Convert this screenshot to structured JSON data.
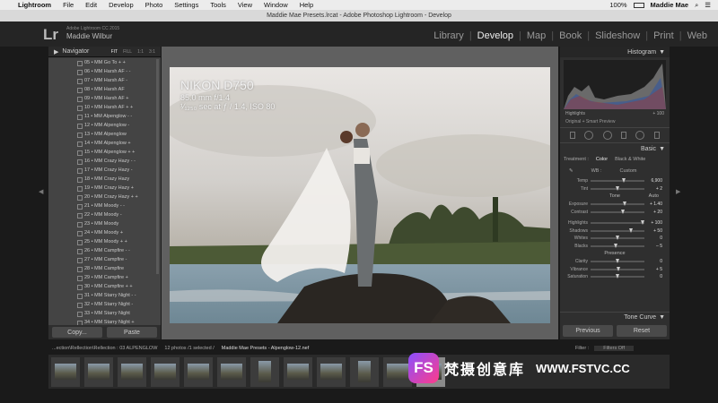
{
  "menubar": {
    "app": "Lightroom",
    "items": [
      "File",
      "Edit",
      "Develop",
      "Photo",
      "Settings",
      "Tools",
      "View",
      "Window",
      "Help"
    ],
    "battery": "100%",
    "user": "Maddie Mae"
  },
  "window_title": "Maddie Mae Presets.lrcat - Adobe Photoshop Lightroom - Develop",
  "identity": {
    "logo": "Lr",
    "version": "Adobe Lightroom CC 2015",
    "user": "Maddie Wilbur"
  },
  "modules": [
    "Library",
    "Develop",
    "Map",
    "Book",
    "Slideshow",
    "Print",
    "Web"
  ],
  "active_module": "Develop",
  "navigator": {
    "label": "Navigator",
    "zoom": [
      "FIT",
      "FILL",
      "1:1",
      "3:1"
    ]
  },
  "presets": [
    "05 • MM Go To + +",
    "06 • MM Harsh AF - -",
    "07 • MM Harsh AF -",
    "08 • MM Harsh AF",
    "09 • MM Harsh AF +",
    "10 • MM Harsh AF + +",
    "11 • MM Alpenglow - -",
    "12 • MM Alpenglow -",
    "13 • MM Alpenglow",
    "14 • MM Alpenglow +",
    "15 • MM Alpenglow + +",
    "16 • MM Crazy Hazy - -",
    "17 • MM Crazy Hazy -",
    "18 • MM Crazy Hazy",
    "19 • MM Crazy Hazy +",
    "20 • MM Crazy Hazy + +",
    "21 • MM Moody - -",
    "22 • MM Moody -",
    "23 • MM Moody",
    "24 • MM Moody +",
    "25 • MM Moody + +",
    "26 • MM Campfire - -",
    "27 • MM Campfire -",
    "28 • MM Campfire",
    "29 • MM Campfire +",
    "30 • MM Campfire + +",
    "31 • MM Starry Night - -",
    "32 • MM Starry Night -",
    "33 • MM Starry Night",
    "34 • MM Starry Night +",
    "35 • MM Starry Night + +"
  ],
  "left_buttons": {
    "copy": "Copy...",
    "paste": "Paste"
  },
  "photo_info": {
    "camera": "NIKON D750",
    "lens": "85.0 mm f/1.4",
    "exposure": "¹⁄₁₂₅₀ sec at ƒ / 1.4, ISO 80"
  },
  "right_panel": {
    "histogram_label": "Histogram",
    "highlights_label": "Highlights",
    "highlights_value": "+ 100",
    "preview_label": "Original + Smart Preview",
    "basic_label": "Basic",
    "treatment_label": "Treatment :",
    "treatment_color": "Color",
    "treatment_bw": "Black & White",
    "wb_label": "WB :",
    "wb_value": "Custom",
    "wb_sliders": [
      {
        "label": "Temp",
        "value": "6,900",
        "pos": 0.62
      },
      {
        "label": "Tint",
        "value": "+ 2",
        "pos": 0.51
      }
    ],
    "tone_label": "Tone",
    "auto_label": "Auto",
    "tone_sliders": [
      {
        "label": "Exposure",
        "value": "+ 1.40",
        "pos": 0.64
      },
      {
        "label": "Contrast",
        "value": "+ 20",
        "pos": 0.6
      }
    ],
    "tone_sliders2": [
      {
        "label": "Highlights",
        "value": "+ 100",
        "pos": 0.98
      },
      {
        "label": "Shadows",
        "value": "+ 50",
        "pos": 0.75
      },
      {
        "label": "Whites",
        "value": "0",
        "pos": 0.5
      },
      {
        "label": "Blacks",
        "value": "– 5",
        "pos": 0.47
      }
    ],
    "presence_label": "Presence",
    "presence_sliders": [
      {
        "label": "Clarity",
        "value": "0",
        "pos": 0.5
      },
      {
        "label": "Vibrance",
        "value": "+ 5",
        "pos": 0.53
      },
      {
        "label": "Saturation",
        "value": "0",
        "pos": 0.5
      }
    ],
    "tone_curve_label": "Tone Curve",
    "previous": "Previous",
    "reset": "Reset"
  },
  "filmstrip": {
    "collection": "...ection\\Rellection\\Rellection : 03 ALPENGLOW",
    "count": "12 photos /1 selected /",
    "filename": "Maddie Mae Presets - Alpenglow-12.nef",
    "filter_label": "Filter :",
    "filter_value": "Filters Off"
  },
  "watermark": {
    "logo": "FS",
    "cn": "梵摄创意库",
    "url": "WWW.FSTVC.CC"
  }
}
